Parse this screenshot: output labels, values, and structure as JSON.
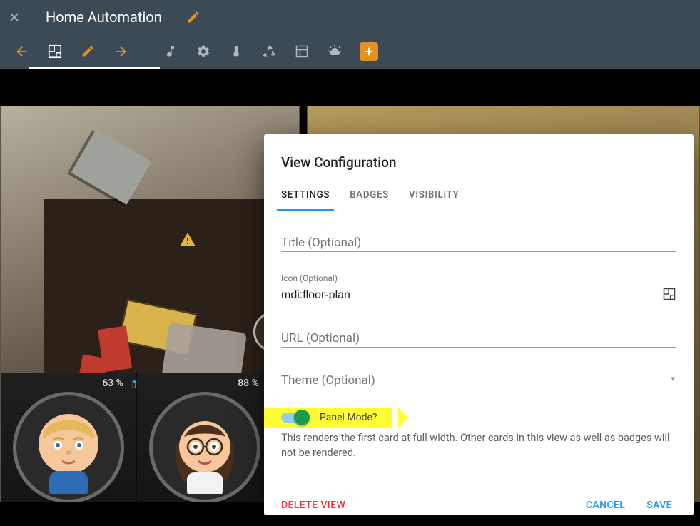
{
  "header": {
    "title": "Home Automation"
  },
  "toolbar": {
    "tooltips": {
      "back": "Back",
      "floorplan": "Floor plan",
      "edit": "Edit",
      "forward": "Forward",
      "music": "Music",
      "settings": "Settings",
      "climate": "Climate",
      "recycle": "Energy",
      "dashboard": "Dashboard",
      "weather": "Weather",
      "add": "Add view"
    }
  },
  "presence": {
    "people": [
      {
        "battery": "63 %"
      },
      {
        "battery": "88 %"
      }
    ]
  },
  "modal": {
    "title": "View Configuration",
    "tabs": {
      "settings": "SETTINGS",
      "badges": "BADGES",
      "visibility": "VISIBILITY"
    },
    "fields": {
      "title_label": "Title (Optional)",
      "title_value": "",
      "icon_label": "Icon (Optional)",
      "icon_value": "mdi:floor-plan",
      "url_label": "URL (Optional)",
      "url_value": "",
      "theme_label": "Theme (Optional)",
      "theme_value": ""
    },
    "panel_mode": {
      "label": "Panel Mode?",
      "enabled": true,
      "description": "This renders the first card at full width. Other cards in this view as well as badges will not be rendered."
    },
    "footer": {
      "delete": "DELETE VIEW",
      "cancel": "CANCEL",
      "save": "SAVE"
    }
  },
  "chart_data": null
}
